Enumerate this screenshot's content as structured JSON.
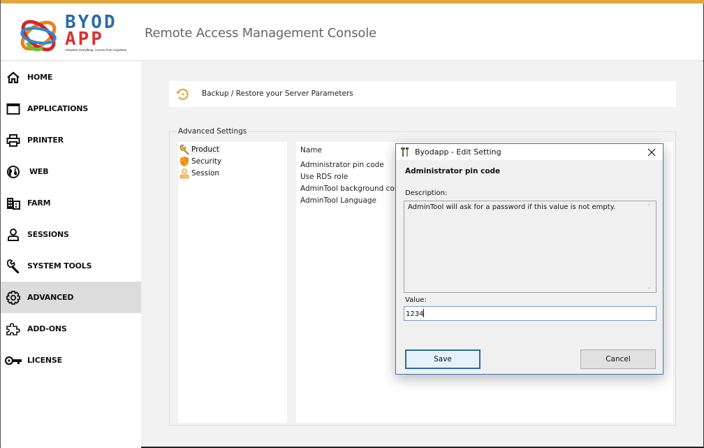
{
  "header": {
    "logo": {
      "line1": "BYOD",
      "line2": "APP",
      "tagline": "Virtualize everything. Access from Anywhere"
    },
    "title": "Remote Access Management Console",
    "accent_color": "#e0a83a"
  },
  "sidebar": {
    "items": [
      {
        "label": "HOME",
        "icon": "home-icon"
      },
      {
        "label": "APPLICATIONS",
        "icon": "window-icon"
      },
      {
        "label": "PRINTER",
        "icon": "printer-icon"
      },
      {
        "label": "WEB",
        "icon": "globe-icon"
      },
      {
        "label": "FARM",
        "icon": "building-icon"
      },
      {
        "label": "SESSIONS",
        "icon": "user-icon"
      },
      {
        "label": "SYSTEM TOOLS",
        "icon": "wrench-icon"
      },
      {
        "label": "ADVANCED",
        "icon": "gear-icon",
        "active": true
      },
      {
        "label": "ADD-ONS",
        "icon": "puzzle-icon"
      },
      {
        "label": "LICENSE",
        "icon": "key-icon"
      }
    ]
  },
  "main": {
    "backup_label": "Backup / Restore your Server Parameters",
    "group_label": "Advanced Settings",
    "tree": [
      {
        "label": "Product",
        "icon": "wrench-icon",
        "selected": true
      },
      {
        "label": "Security",
        "icon": "shield-icon"
      },
      {
        "label": "Session",
        "icon": "user-icon"
      }
    ],
    "list": {
      "header": "Name",
      "rows": [
        "Administrator pin code",
        "Use RDS role",
        "AdminTool background color",
        "AdminTool Language"
      ]
    }
  },
  "dialog": {
    "title": "Byodapp - Edit Setting",
    "heading": "Administrator pin code",
    "description_label": "Description:",
    "description": "AdminTool will ask for a password if this value is not empty.",
    "value_label": "Value:",
    "value": "1234",
    "save_label": "Save",
    "cancel_label": "Cancel"
  }
}
